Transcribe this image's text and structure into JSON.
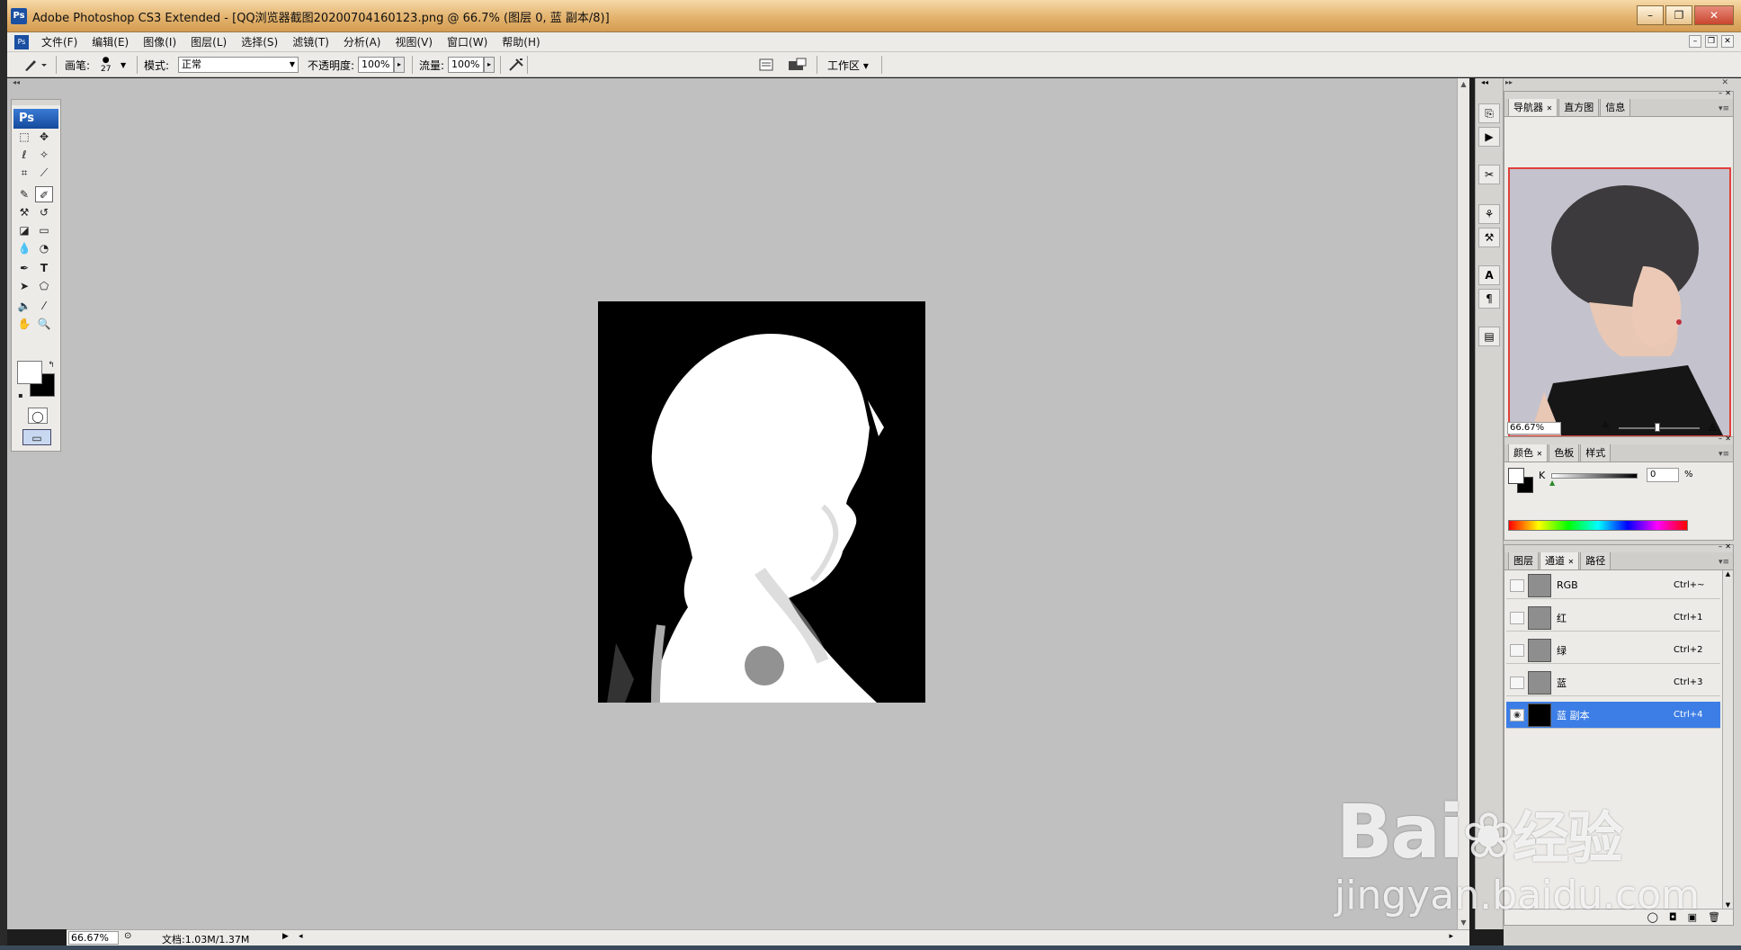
{
  "window": {
    "title": "Adobe Photoshop CS3 Extended - [QQ浏览器截图20200704160123.png @ 66.7% (图层 0, 蓝 副本/8)]",
    "app_badge": "Ps"
  },
  "menu": [
    "文件(F)",
    "编辑(E)",
    "图像(I)",
    "图层(L)",
    "选择(S)",
    "滤镜(T)",
    "分析(A)",
    "视图(V)",
    "窗口(W)",
    "帮助(H)"
  ],
  "options": {
    "brush_label": "画笔:",
    "brush_size": "27",
    "mode_label": "模式:",
    "mode_value": "正常",
    "opacity_label": "不透明度:",
    "opacity_value": "100%",
    "flow_label": "流量:",
    "flow_value": "100%",
    "workspace_label": "工作区 ▾"
  },
  "toolbox": {
    "logo": "Ps"
  },
  "status": {
    "zoom": "66.67%",
    "doc_info": "文档:1.03M/1.37M"
  },
  "navigator": {
    "tabs": [
      "导航器",
      "直方图",
      "信息"
    ],
    "zoom": "66.67%"
  },
  "color_panel": {
    "tabs": [
      "颜色",
      "色板",
      "样式"
    ],
    "channel_label": "K",
    "channel_value": "0",
    "unit": "%"
  },
  "channels_panel": {
    "tabs": [
      "图层",
      "通道",
      "路径"
    ],
    "rows": [
      {
        "name": "RGB",
        "shortcut": "Ctrl+~"
      },
      {
        "name": "红",
        "shortcut": "Ctrl+1"
      },
      {
        "name": "绿",
        "shortcut": "Ctrl+2"
      },
      {
        "name": "蓝",
        "shortcut": "Ctrl+3"
      },
      {
        "name": "蓝 副本",
        "shortcut": "Ctrl+4"
      }
    ]
  },
  "watermark": {
    "brand": "Bai",
    "brand2": "经验",
    "url": "jingyan.baidu.com"
  }
}
